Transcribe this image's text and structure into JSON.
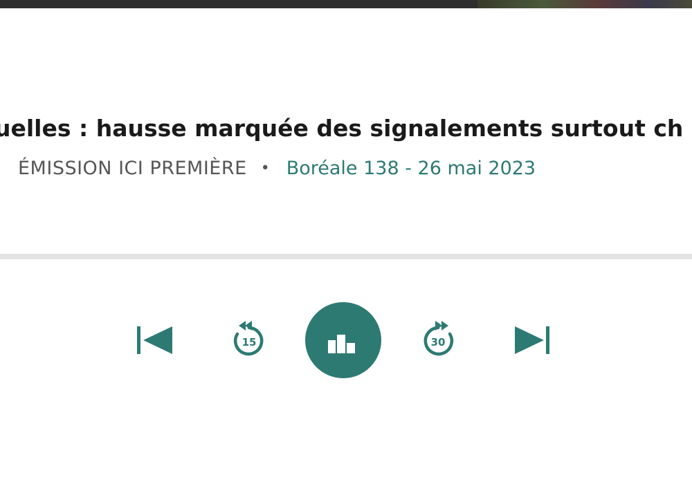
{
  "episode": {
    "title": "uelles :  hausse marquée des signalements surtout ch",
    "show_label": "ÉMISSION ICI PREMIÈRE",
    "separator": "•",
    "episode_label": "Boréale 138 - 26 mai 2023"
  },
  "player": {
    "progress_percent": 0,
    "skip_back_seconds": "15",
    "skip_forward_seconds": "30",
    "state": "playing"
  },
  "colors": {
    "accent": "#2d7a73",
    "title_text": "#1a1a1a",
    "meta_text": "#555555",
    "track": "#e3e3e3"
  },
  "icons": {
    "previous": "skip-previous-icon",
    "rewind": "rewind-15-icon",
    "play_state": "audio-bars-icon",
    "forward": "forward-30-icon",
    "next": "skip-next-icon"
  }
}
